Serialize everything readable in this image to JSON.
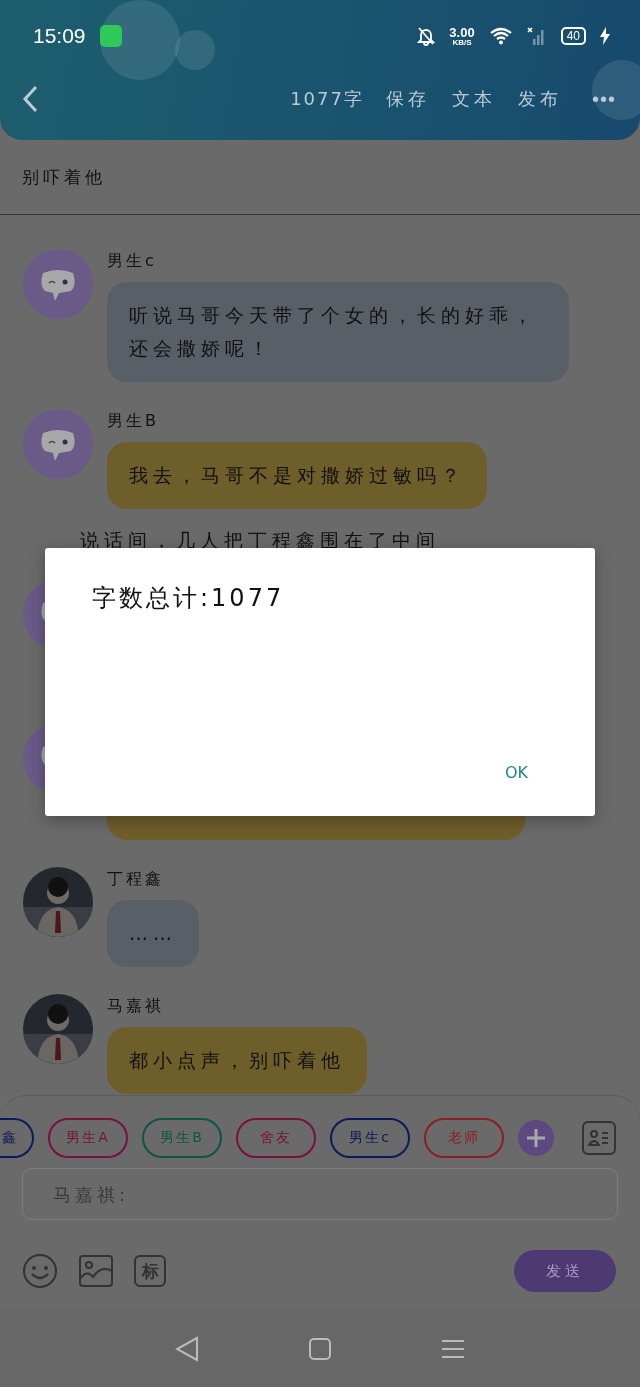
{
  "status_bar": {
    "time": "15:09",
    "speed": "3.00",
    "speed_unit": "KB/S",
    "battery": "40"
  },
  "header": {
    "word_count": "1077字",
    "actions": [
      "保存",
      "文本",
      "发布"
    ],
    "more": "•••"
  },
  "subtitle": "别吓着他",
  "chat": [
    {
      "kind": "message",
      "name": "男生c",
      "avatar": {
        "kind": "icon"
      },
      "color": "#595f66",
      "text": "听说马哥今天带了个女的，长的好乖，还会撒娇呢！"
    },
    {
      "kind": "message",
      "name": "男生B",
      "avatar": {
        "kind": "icon"
      },
      "color": "#6e5e2a",
      "text": "我去，马哥不是对撒娇过敏吗？"
    },
    {
      "kind": "narration",
      "text": "说话间，几人把丁程鑫围在了中间"
    },
    {
      "kind": "covered",
      "avatar": {
        "kind": "icon"
      }
    },
    {
      "kind": "covered",
      "avatar": {
        "kind": "icon"
      },
      "color": "#6e5e2a"
    },
    {
      "kind": "message",
      "name": "丁程鑫",
      "color": "#595f66",
      "text": "……"
    },
    {
      "kind": "message",
      "name": "马嘉祺",
      "color": "#6e5e2a",
      "text": "都小点声，别吓着他"
    }
  ],
  "roles": [
    {
      "label": "鑫",
      "color": "#0d1a5a"
    },
    {
      "label": "男生A",
      "color": "#7a1040"
    },
    {
      "label": "男生B",
      "color": "#0f5446"
    },
    {
      "label": "舍友",
      "color": "#7a1040"
    },
    {
      "label": "男生c",
      "color": "#0d1a5a"
    },
    {
      "label": "老师",
      "color": "#8a2020"
    }
  ],
  "input": {
    "placeholder": "马嘉祺:"
  },
  "tools": {
    "tag": "标"
  },
  "send": "发送",
  "dialog": {
    "message": "字数总计:1077",
    "button": "OK"
  }
}
